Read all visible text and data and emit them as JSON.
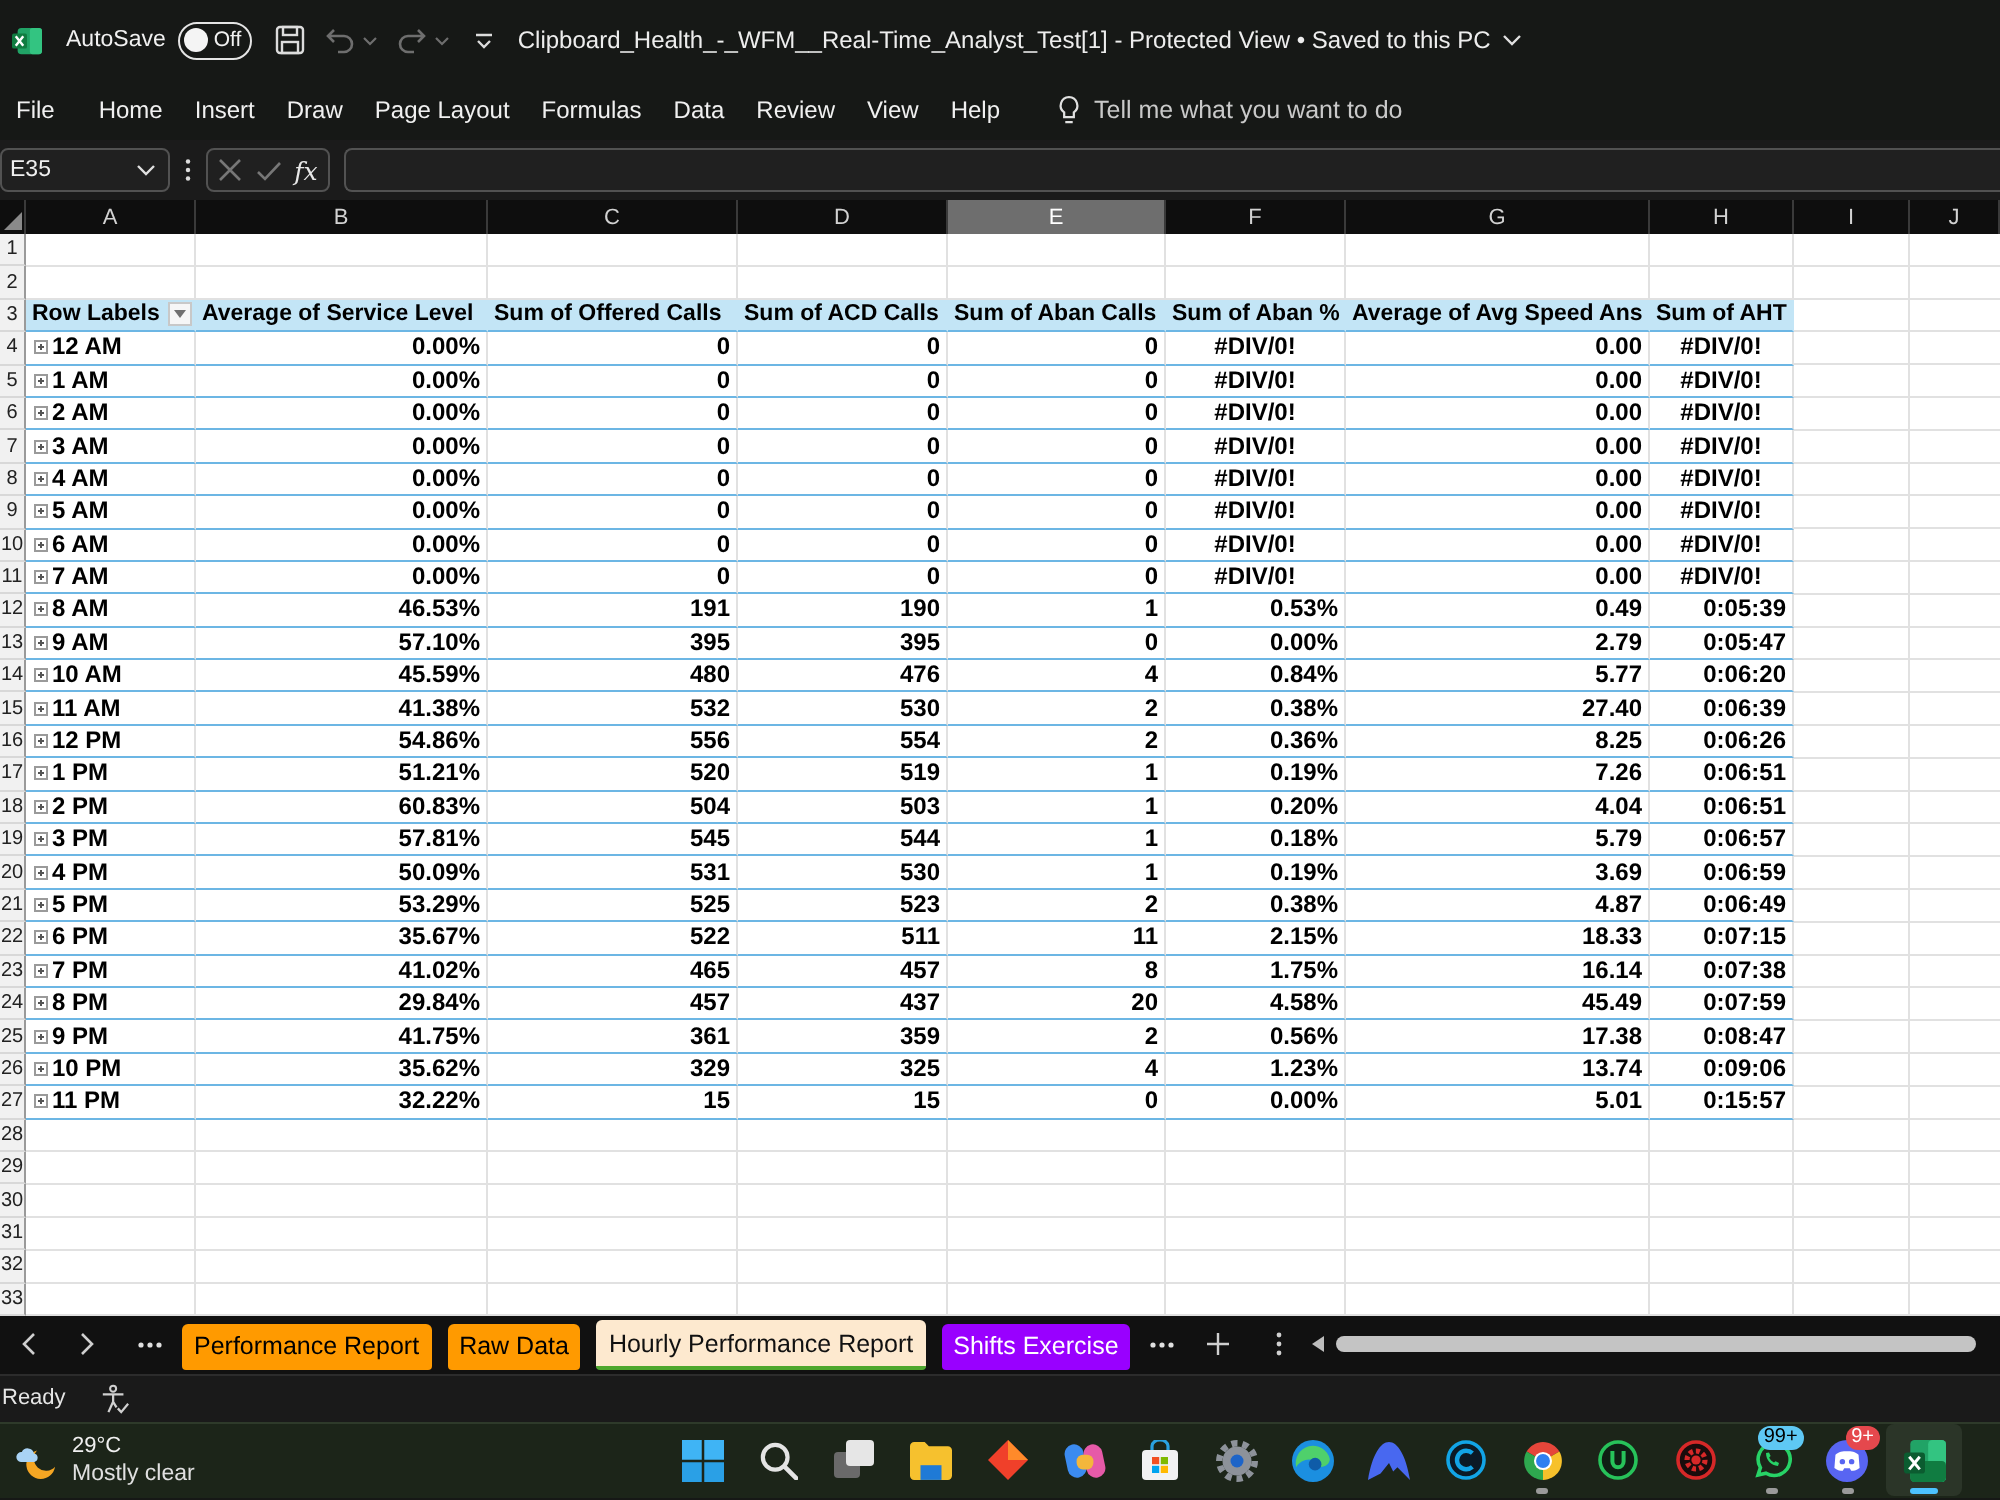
{
  "title_bar": {
    "autosave_label": "AutoSave",
    "autosave_on": false,
    "autosave_state": "Off",
    "undo_disabled": true,
    "redo_disabled": true,
    "document_title": "Clipboard_Health_-_WFM__Real-Time_Analyst_Test[1] - Protected View • Saved to this PC"
  },
  "menu": [
    {
      "label": "File",
      "selected": false
    },
    {
      "label": "Home",
      "selected": false
    },
    {
      "label": "Insert",
      "selected": false
    },
    {
      "label": "Draw",
      "selected": false
    },
    {
      "label": "Page Layout",
      "selected": false
    },
    {
      "label": "Formulas",
      "selected": false
    },
    {
      "label": "Data",
      "selected": false
    },
    {
      "label": "Review",
      "selected": false
    },
    {
      "label": "View",
      "selected": false
    },
    {
      "label": "Help",
      "selected": false
    }
  ],
  "tell_me": {
    "placeholder": "Tell me what you want to do"
  },
  "formula_bar": {
    "name_box": "E35",
    "cancel_disabled": true,
    "enter_disabled": true,
    "function_label": "fx"
  },
  "sheet": {
    "columns": [
      {
        "letter": "A",
        "selected": false
      },
      {
        "letter": "B",
        "selected": false
      },
      {
        "letter": "C",
        "selected": false
      },
      {
        "letter": "D",
        "selected": false
      },
      {
        "letter": "E",
        "selected": true
      },
      {
        "letter": "F",
        "selected": false
      },
      {
        "letter": "G",
        "selected": false
      },
      {
        "letter": "H",
        "selected": false
      },
      {
        "letter": "I",
        "selected": false
      },
      {
        "letter": "J",
        "selected": false
      }
    ],
    "row_numbers": [
      "1",
      "2",
      "3",
      "4",
      "5",
      "6",
      "7",
      "8",
      "9",
      "10",
      "11",
      "12",
      "13",
      "14",
      "15",
      "16",
      "17",
      "18",
      "19",
      "20",
      "21",
      "22",
      "23",
      "24",
      "25",
      "26",
      "27",
      "28",
      "29",
      "30",
      "31",
      "32",
      "33"
    ]
  },
  "pivot": {
    "headers": [
      "Row Labels",
      "Average of Service Level",
      "Sum of Offered Calls",
      "Sum of ACD Calls",
      "Sum of Aban Calls",
      "Sum of Aban %",
      "Average of Avg Speed Ans",
      "Sum of AHT"
    ],
    "rows": [
      {
        "label": "12 AM",
        "expanded": false,
        "cells": [
          {
            "text": "0.00%",
            "kind": "number"
          },
          {
            "text": "0",
            "kind": "number"
          },
          {
            "text": "0",
            "kind": "number"
          },
          {
            "text": "0",
            "kind": "number"
          },
          {
            "text": "#DIV/0!",
            "kind": "error"
          },
          {
            "text": "0.00",
            "kind": "number"
          },
          {
            "text": "#DIV/0!",
            "kind": "error"
          }
        ]
      },
      {
        "label": "1 AM",
        "expanded": false,
        "cells": [
          {
            "text": "0.00%",
            "kind": "number"
          },
          {
            "text": "0",
            "kind": "number"
          },
          {
            "text": "0",
            "kind": "number"
          },
          {
            "text": "0",
            "kind": "number"
          },
          {
            "text": "#DIV/0!",
            "kind": "error"
          },
          {
            "text": "0.00",
            "kind": "number"
          },
          {
            "text": "#DIV/0!",
            "kind": "error"
          }
        ]
      },
      {
        "label": "2 AM",
        "expanded": false,
        "cells": [
          {
            "text": "0.00%",
            "kind": "number"
          },
          {
            "text": "0",
            "kind": "number"
          },
          {
            "text": "0",
            "kind": "number"
          },
          {
            "text": "0",
            "kind": "number"
          },
          {
            "text": "#DIV/0!",
            "kind": "error"
          },
          {
            "text": "0.00",
            "kind": "number"
          },
          {
            "text": "#DIV/0!",
            "kind": "error"
          }
        ]
      },
      {
        "label": "3 AM",
        "expanded": false,
        "cells": [
          {
            "text": "0.00%",
            "kind": "number"
          },
          {
            "text": "0",
            "kind": "number"
          },
          {
            "text": "0",
            "kind": "number"
          },
          {
            "text": "0",
            "kind": "number"
          },
          {
            "text": "#DIV/0!",
            "kind": "error"
          },
          {
            "text": "0.00",
            "kind": "number"
          },
          {
            "text": "#DIV/0!",
            "kind": "error"
          }
        ]
      },
      {
        "label": "4 AM",
        "expanded": false,
        "cells": [
          {
            "text": "0.00%",
            "kind": "number"
          },
          {
            "text": "0",
            "kind": "number"
          },
          {
            "text": "0",
            "kind": "number"
          },
          {
            "text": "0",
            "kind": "number"
          },
          {
            "text": "#DIV/0!",
            "kind": "error"
          },
          {
            "text": "0.00",
            "kind": "number"
          },
          {
            "text": "#DIV/0!",
            "kind": "error"
          }
        ]
      },
      {
        "label": "5 AM",
        "expanded": false,
        "cells": [
          {
            "text": "0.00%",
            "kind": "number"
          },
          {
            "text": "0",
            "kind": "number"
          },
          {
            "text": "0",
            "kind": "number"
          },
          {
            "text": "0",
            "kind": "number"
          },
          {
            "text": "#DIV/0!",
            "kind": "error"
          },
          {
            "text": "0.00",
            "kind": "number"
          },
          {
            "text": "#DIV/0!",
            "kind": "error"
          }
        ]
      },
      {
        "label": "6 AM",
        "expanded": false,
        "cells": [
          {
            "text": "0.00%",
            "kind": "number"
          },
          {
            "text": "0",
            "kind": "number"
          },
          {
            "text": "0",
            "kind": "number"
          },
          {
            "text": "0",
            "kind": "number"
          },
          {
            "text": "#DIV/0!",
            "kind": "error"
          },
          {
            "text": "0.00",
            "kind": "number"
          },
          {
            "text": "#DIV/0!",
            "kind": "error"
          }
        ]
      },
      {
        "label": "7 AM",
        "expanded": false,
        "cells": [
          {
            "text": "0.00%",
            "kind": "number"
          },
          {
            "text": "0",
            "kind": "number"
          },
          {
            "text": "0",
            "kind": "number"
          },
          {
            "text": "0",
            "kind": "number"
          },
          {
            "text": "#DIV/0!",
            "kind": "error"
          },
          {
            "text": "0.00",
            "kind": "number"
          },
          {
            "text": "#DIV/0!",
            "kind": "error"
          }
        ]
      },
      {
        "label": "8 AM",
        "expanded": false,
        "cells": [
          {
            "text": "46.53%",
            "kind": "number"
          },
          {
            "text": "191",
            "kind": "number"
          },
          {
            "text": "190",
            "kind": "number"
          },
          {
            "text": "1",
            "kind": "number"
          },
          {
            "text": "0.53%",
            "kind": "number"
          },
          {
            "text": "0.49",
            "kind": "number"
          },
          {
            "text": "0:05:39",
            "kind": "number"
          }
        ]
      },
      {
        "label": "9 AM",
        "expanded": false,
        "cells": [
          {
            "text": "57.10%",
            "kind": "number"
          },
          {
            "text": "395",
            "kind": "number"
          },
          {
            "text": "395",
            "kind": "number"
          },
          {
            "text": "0",
            "kind": "number"
          },
          {
            "text": "0.00%",
            "kind": "number"
          },
          {
            "text": "2.79",
            "kind": "number"
          },
          {
            "text": "0:05:47",
            "kind": "number"
          }
        ]
      },
      {
        "label": "10 AM",
        "expanded": false,
        "cells": [
          {
            "text": "45.59%",
            "kind": "number"
          },
          {
            "text": "480",
            "kind": "number"
          },
          {
            "text": "476",
            "kind": "number"
          },
          {
            "text": "4",
            "kind": "number"
          },
          {
            "text": "0.84%",
            "kind": "number"
          },
          {
            "text": "5.77",
            "kind": "number"
          },
          {
            "text": "0:06:20",
            "kind": "number"
          }
        ]
      },
      {
        "label": "11 AM",
        "expanded": false,
        "cells": [
          {
            "text": "41.38%",
            "kind": "number"
          },
          {
            "text": "532",
            "kind": "number"
          },
          {
            "text": "530",
            "kind": "number"
          },
          {
            "text": "2",
            "kind": "number"
          },
          {
            "text": "0.38%",
            "kind": "number"
          },
          {
            "text": "27.40",
            "kind": "number"
          },
          {
            "text": "0:06:39",
            "kind": "number"
          }
        ]
      },
      {
        "label": "12 PM",
        "expanded": false,
        "cells": [
          {
            "text": "54.86%",
            "kind": "number"
          },
          {
            "text": "556",
            "kind": "number"
          },
          {
            "text": "554",
            "kind": "number"
          },
          {
            "text": "2",
            "kind": "number"
          },
          {
            "text": "0.36%",
            "kind": "number"
          },
          {
            "text": "8.25",
            "kind": "number"
          },
          {
            "text": "0:06:26",
            "kind": "number"
          }
        ]
      },
      {
        "label": "1 PM",
        "expanded": false,
        "cells": [
          {
            "text": "51.21%",
            "kind": "number"
          },
          {
            "text": "520",
            "kind": "number"
          },
          {
            "text": "519",
            "kind": "number"
          },
          {
            "text": "1",
            "kind": "number"
          },
          {
            "text": "0.19%",
            "kind": "number"
          },
          {
            "text": "7.26",
            "kind": "number"
          },
          {
            "text": "0:06:51",
            "kind": "number"
          }
        ]
      },
      {
        "label": "2 PM",
        "expanded": false,
        "cells": [
          {
            "text": "60.83%",
            "kind": "number"
          },
          {
            "text": "504",
            "kind": "number"
          },
          {
            "text": "503",
            "kind": "number"
          },
          {
            "text": "1",
            "kind": "number"
          },
          {
            "text": "0.20%",
            "kind": "number"
          },
          {
            "text": "4.04",
            "kind": "number"
          },
          {
            "text": "0:06:51",
            "kind": "number"
          }
        ]
      },
      {
        "label": "3 PM",
        "expanded": false,
        "cells": [
          {
            "text": "57.81%",
            "kind": "number"
          },
          {
            "text": "545",
            "kind": "number"
          },
          {
            "text": "544",
            "kind": "number"
          },
          {
            "text": "1",
            "kind": "number"
          },
          {
            "text": "0.18%",
            "kind": "number"
          },
          {
            "text": "5.79",
            "kind": "number"
          },
          {
            "text": "0:06:57",
            "kind": "number"
          }
        ]
      },
      {
        "label": "4 PM",
        "expanded": false,
        "cells": [
          {
            "text": "50.09%",
            "kind": "number"
          },
          {
            "text": "531",
            "kind": "number"
          },
          {
            "text": "530",
            "kind": "number"
          },
          {
            "text": "1",
            "kind": "number"
          },
          {
            "text": "0.19%",
            "kind": "number"
          },
          {
            "text": "3.69",
            "kind": "number"
          },
          {
            "text": "0:06:59",
            "kind": "number"
          }
        ]
      },
      {
        "label": "5 PM",
        "expanded": false,
        "cells": [
          {
            "text": "53.29%",
            "kind": "number"
          },
          {
            "text": "525",
            "kind": "number"
          },
          {
            "text": "523",
            "kind": "number"
          },
          {
            "text": "2",
            "kind": "number"
          },
          {
            "text": "0.38%",
            "kind": "number"
          },
          {
            "text": "4.87",
            "kind": "number"
          },
          {
            "text": "0:06:49",
            "kind": "number"
          }
        ]
      },
      {
        "label": "6 PM",
        "expanded": false,
        "cells": [
          {
            "text": "35.67%",
            "kind": "number"
          },
          {
            "text": "522",
            "kind": "number"
          },
          {
            "text": "511",
            "kind": "number"
          },
          {
            "text": "11",
            "kind": "number"
          },
          {
            "text": "2.15%",
            "kind": "number"
          },
          {
            "text": "18.33",
            "kind": "number"
          },
          {
            "text": "0:07:15",
            "kind": "number"
          }
        ]
      },
      {
        "label": "7 PM",
        "expanded": false,
        "cells": [
          {
            "text": "41.02%",
            "kind": "number"
          },
          {
            "text": "465",
            "kind": "number"
          },
          {
            "text": "457",
            "kind": "number"
          },
          {
            "text": "8",
            "kind": "number"
          },
          {
            "text": "1.75%",
            "kind": "number"
          },
          {
            "text": "16.14",
            "kind": "number"
          },
          {
            "text": "0:07:38",
            "kind": "number"
          }
        ]
      },
      {
        "label": "8 PM",
        "expanded": false,
        "cells": [
          {
            "text": "29.84%",
            "kind": "number"
          },
          {
            "text": "457",
            "kind": "number"
          },
          {
            "text": "437",
            "kind": "number"
          },
          {
            "text": "20",
            "kind": "number"
          },
          {
            "text": "4.58%",
            "kind": "number"
          },
          {
            "text": "45.49",
            "kind": "number"
          },
          {
            "text": "0:07:59",
            "kind": "number"
          }
        ]
      },
      {
        "label": "9 PM",
        "expanded": false,
        "cells": [
          {
            "text": "41.75%",
            "kind": "number"
          },
          {
            "text": "361",
            "kind": "number"
          },
          {
            "text": "359",
            "kind": "number"
          },
          {
            "text": "2",
            "kind": "number"
          },
          {
            "text": "0.56%",
            "kind": "number"
          },
          {
            "text": "17.38",
            "kind": "number"
          },
          {
            "text": "0:08:47",
            "kind": "number"
          }
        ]
      },
      {
        "label": "10 PM",
        "expanded": false,
        "cells": [
          {
            "text": "35.62%",
            "kind": "number"
          },
          {
            "text": "329",
            "kind": "number"
          },
          {
            "text": "325",
            "kind": "number"
          },
          {
            "text": "4",
            "kind": "number"
          },
          {
            "text": "1.23%",
            "kind": "number"
          },
          {
            "text": "13.74",
            "kind": "number"
          },
          {
            "text": "0:09:06",
            "kind": "number"
          }
        ]
      },
      {
        "label": "11 PM",
        "expanded": false,
        "cells": [
          {
            "text": "32.22%",
            "kind": "number"
          },
          {
            "text": "15",
            "kind": "number"
          },
          {
            "text": "15",
            "kind": "number"
          },
          {
            "text": "0",
            "kind": "number"
          },
          {
            "text": "0.00%",
            "kind": "number"
          },
          {
            "text": "5.01",
            "kind": "number"
          },
          {
            "text": "0:15:57",
            "kind": "number"
          }
        ]
      }
    ]
  },
  "sheet_tabs": [
    {
      "label": "Performance Report",
      "color": "#ff9a00",
      "selected": false
    },
    {
      "label": "Raw Data",
      "color": "#ff9a00",
      "selected": false
    },
    {
      "label": "Hourly Performance Report",
      "color": "#4ea72e",
      "selected": true
    },
    {
      "label": "Shifts Exercise",
      "color": "#9900ff",
      "selected": false
    }
  ],
  "status_bar": {
    "text": "Ready"
  },
  "taskbar": {
    "weather": {
      "temperature": "29°C",
      "condition": "Mostly clear"
    },
    "apps": [
      {
        "kind": "start",
        "running": false,
        "selected": false
      },
      {
        "kind": "search",
        "running": false,
        "selected": false
      },
      {
        "kind": "task_view",
        "running": false,
        "selected": false
      },
      {
        "kind": "explorer",
        "running": false,
        "selected": false
      },
      {
        "kind": "diamond",
        "running": false,
        "selected": false
      },
      {
        "kind": "copilot",
        "running": false,
        "selected": false
      },
      {
        "kind": "store",
        "running": false,
        "selected": false
      },
      {
        "kind": "settings",
        "running": false,
        "selected": false
      },
      {
        "kind": "edge",
        "running": false,
        "selected": false
      },
      {
        "kind": "mountain",
        "running": false,
        "selected": false
      },
      {
        "kind": "c_app",
        "running": false,
        "selected": false
      },
      {
        "kind": "chrome",
        "running": true,
        "selected": false
      },
      {
        "kind": "u_app",
        "running": false,
        "selected": false
      },
      {
        "kind": "red_app",
        "running": false,
        "selected": false
      },
      {
        "kind": "whatsapp",
        "running": true,
        "selected": false,
        "badge": {
          "text": "99+",
          "color": "#5ec8f4"
        }
      },
      {
        "kind": "discord",
        "running": true,
        "selected": false,
        "badge": {
          "text": "9+",
          "color": "#e5484d"
        }
      },
      {
        "kind": "excel",
        "running": true,
        "selected": true
      }
    ]
  }
}
